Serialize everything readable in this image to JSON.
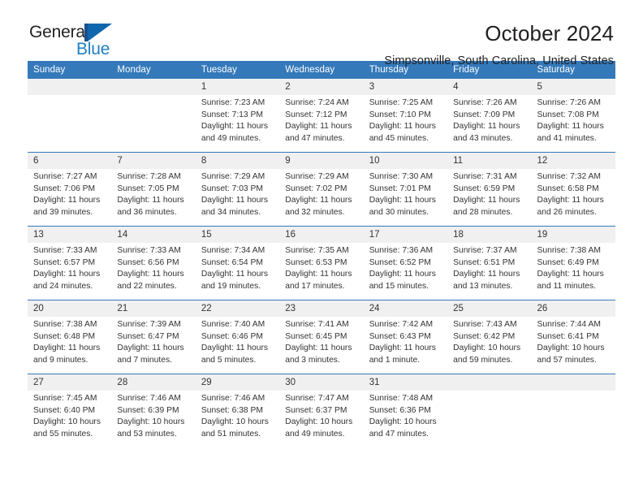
{
  "brand": {
    "word_one": "General",
    "word_two": "Blue",
    "logo_icon": "flag-triangle-icon",
    "accent_color": "#1067ad",
    "dark_color": "#1b4f8a"
  },
  "header": {
    "month_title": "October 2024",
    "location": "Simpsonville, South Carolina, United States"
  },
  "theme": {
    "header_row_bg": "#3479ba",
    "daynum_bg": "#f0f0f0",
    "text_color": "#333333"
  },
  "columns": [
    "Sunday",
    "Monday",
    "Tuesday",
    "Wednesday",
    "Thursday",
    "Friday",
    "Saturday"
  ],
  "weeks": [
    [
      {
        "day": "",
        "sunrise": "",
        "sunset": "",
        "daylight_line1": "",
        "daylight_line2": ""
      },
      {
        "day": "",
        "sunrise": "",
        "sunset": "",
        "daylight_line1": "",
        "daylight_line2": ""
      },
      {
        "day": "1",
        "sunrise": "Sunrise: 7:23 AM",
        "sunset": "Sunset: 7:13 PM",
        "daylight_line1": "Daylight: 11 hours",
        "daylight_line2": "and 49 minutes."
      },
      {
        "day": "2",
        "sunrise": "Sunrise: 7:24 AM",
        "sunset": "Sunset: 7:12 PM",
        "daylight_line1": "Daylight: 11 hours",
        "daylight_line2": "and 47 minutes."
      },
      {
        "day": "3",
        "sunrise": "Sunrise: 7:25 AM",
        "sunset": "Sunset: 7:10 PM",
        "daylight_line1": "Daylight: 11 hours",
        "daylight_line2": "and 45 minutes."
      },
      {
        "day": "4",
        "sunrise": "Sunrise: 7:26 AM",
        "sunset": "Sunset: 7:09 PM",
        "daylight_line1": "Daylight: 11 hours",
        "daylight_line2": "and 43 minutes."
      },
      {
        "day": "5",
        "sunrise": "Sunrise: 7:26 AM",
        "sunset": "Sunset: 7:08 PM",
        "daylight_line1": "Daylight: 11 hours",
        "daylight_line2": "and 41 minutes."
      }
    ],
    [
      {
        "day": "6",
        "sunrise": "Sunrise: 7:27 AM",
        "sunset": "Sunset: 7:06 PM",
        "daylight_line1": "Daylight: 11 hours",
        "daylight_line2": "and 39 minutes."
      },
      {
        "day": "7",
        "sunrise": "Sunrise: 7:28 AM",
        "sunset": "Sunset: 7:05 PM",
        "daylight_line1": "Daylight: 11 hours",
        "daylight_line2": "and 36 minutes."
      },
      {
        "day": "8",
        "sunrise": "Sunrise: 7:29 AM",
        "sunset": "Sunset: 7:03 PM",
        "daylight_line1": "Daylight: 11 hours",
        "daylight_line2": "and 34 minutes."
      },
      {
        "day": "9",
        "sunrise": "Sunrise: 7:29 AM",
        "sunset": "Sunset: 7:02 PM",
        "daylight_line1": "Daylight: 11 hours",
        "daylight_line2": "and 32 minutes."
      },
      {
        "day": "10",
        "sunrise": "Sunrise: 7:30 AM",
        "sunset": "Sunset: 7:01 PM",
        "daylight_line1": "Daylight: 11 hours",
        "daylight_line2": "and 30 minutes."
      },
      {
        "day": "11",
        "sunrise": "Sunrise: 7:31 AM",
        "sunset": "Sunset: 6:59 PM",
        "daylight_line1": "Daylight: 11 hours",
        "daylight_line2": "and 28 minutes."
      },
      {
        "day": "12",
        "sunrise": "Sunrise: 7:32 AM",
        "sunset": "Sunset: 6:58 PM",
        "daylight_line1": "Daylight: 11 hours",
        "daylight_line2": "and 26 minutes."
      }
    ],
    [
      {
        "day": "13",
        "sunrise": "Sunrise: 7:33 AM",
        "sunset": "Sunset: 6:57 PM",
        "daylight_line1": "Daylight: 11 hours",
        "daylight_line2": "and 24 minutes."
      },
      {
        "day": "14",
        "sunrise": "Sunrise: 7:33 AM",
        "sunset": "Sunset: 6:56 PM",
        "daylight_line1": "Daylight: 11 hours",
        "daylight_line2": "and 22 minutes."
      },
      {
        "day": "15",
        "sunrise": "Sunrise: 7:34 AM",
        "sunset": "Sunset: 6:54 PM",
        "daylight_line1": "Daylight: 11 hours",
        "daylight_line2": "and 19 minutes."
      },
      {
        "day": "16",
        "sunrise": "Sunrise: 7:35 AM",
        "sunset": "Sunset: 6:53 PM",
        "daylight_line1": "Daylight: 11 hours",
        "daylight_line2": "and 17 minutes."
      },
      {
        "day": "17",
        "sunrise": "Sunrise: 7:36 AM",
        "sunset": "Sunset: 6:52 PM",
        "daylight_line1": "Daylight: 11 hours",
        "daylight_line2": "and 15 minutes."
      },
      {
        "day": "18",
        "sunrise": "Sunrise: 7:37 AM",
        "sunset": "Sunset: 6:51 PM",
        "daylight_line1": "Daylight: 11 hours",
        "daylight_line2": "and 13 minutes."
      },
      {
        "day": "19",
        "sunrise": "Sunrise: 7:38 AM",
        "sunset": "Sunset: 6:49 PM",
        "daylight_line1": "Daylight: 11 hours",
        "daylight_line2": "and 11 minutes."
      }
    ],
    [
      {
        "day": "20",
        "sunrise": "Sunrise: 7:38 AM",
        "sunset": "Sunset: 6:48 PM",
        "daylight_line1": "Daylight: 11 hours",
        "daylight_line2": "and 9 minutes."
      },
      {
        "day": "21",
        "sunrise": "Sunrise: 7:39 AM",
        "sunset": "Sunset: 6:47 PM",
        "daylight_line1": "Daylight: 11 hours",
        "daylight_line2": "and 7 minutes."
      },
      {
        "day": "22",
        "sunrise": "Sunrise: 7:40 AM",
        "sunset": "Sunset: 6:46 PM",
        "daylight_line1": "Daylight: 11 hours",
        "daylight_line2": "and 5 minutes."
      },
      {
        "day": "23",
        "sunrise": "Sunrise: 7:41 AM",
        "sunset": "Sunset: 6:45 PM",
        "daylight_line1": "Daylight: 11 hours",
        "daylight_line2": "and 3 minutes."
      },
      {
        "day": "24",
        "sunrise": "Sunrise: 7:42 AM",
        "sunset": "Sunset: 6:43 PM",
        "daylight_line1": "Daylight: 11 hours",
        "daylight_line2": "and 1 minute."
      },
      {
        "day": "25",
        "sunrise": "Sunrise: 7:43 AM",
        "sunset": "Sunset: 6:42 PM",
        "daylight_line1": "Daylight: 10 hours",
        "daylight_line2": "and 59 minutes."
      },
      {
        "day": "26",
        "sunrise": "Sunrise: 7:44 AM",
        "sunset": "Sunset: 6:41 PM",
        "daylight_line1": "Daylight: 10 hours",
        "daylight_line2": "and 57 minutes."
      }
    ],
    [
      {
        "day": "27",
        "sunrise": "Sunrise: 7:45 AM",
        "sunset": "Sunset: 6:40 PM",
        "daylight_line1": "Daylight: 10 hours",
        "daylight_line2": "and 55 minutes."
      },
      {
        "day": "28",
        "sunrise": "Sunrise: 7:46 AM",
        "sunset": "Sunset: 6:39 PM",
        "daylight_line1": "Daylight: 10 hours",
        "daylight_line2": "and 53 minutes."
      },
      {
        "day": "29",
        "sunrise": "Sunrise: 7:46 AM",
        "sunset": "Sunset: 6:38 PM",
        "daylight_line1": "Daylight: 10 hours",
        "daylight_line2": "and 51 minutes."
      },
      {
        "day": "30",
        "sunrise": "Sunrise: 7:47 AM",
        "sunset": "Sunset: 6:37 PM",
        "daylight_line1": "Daylight: 10 hours",
        "daylight_line2": "and 49 minutes."
      },
      {
        "day": "31",
        "sunrise": "Sunrise: 7:48 AM",
        "sunset": "Sunset: 6:36 PM",
        "daylight_line1": "Daylight: 10 hours",
        "daylight_line2": "and 47 minutes."
      },
      {
        "day": "",
        "sunrise": "",
        "sunset": "",
        "daylight_line1": "",
        "daylight_line2": ""
      },
      {
        "day": "",
        "sunrise": "",
        "sunset": "",
        "daylight_line1": "",
        "daylight_line2": ""
      }
    ]
  ]
}
